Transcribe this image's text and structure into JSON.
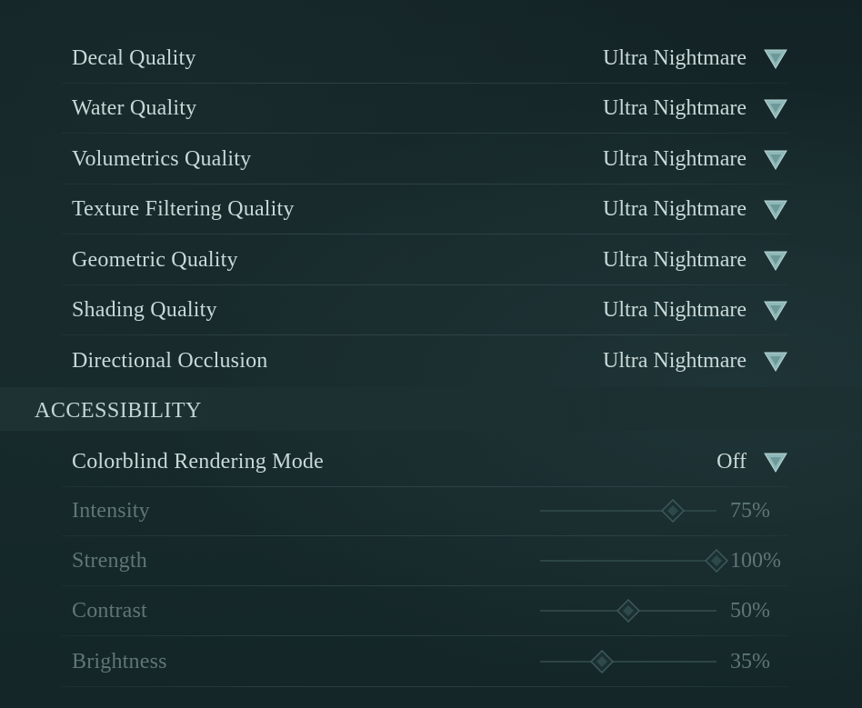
{
  "graphics_settings": [
    {
      "label": "Decal Quality",
      "value": "Ultra Nightmare"
    },
    {
      "label": "Water Quality",
      "value": "Ultra Nightmare"
    },
    {
      "label": "Volumetrics Quality",
      "value": "Ultra Nightmare"
    },
    {
      "label": "Texture Filtering Quality",
      "value": "Ultra Nightmare"
    },
    {
      "label": "Geometric Quality",
      "value": "Ultra Nightmare"
    },
    {
      "label": "Shading Quality",
      "value": "Ultra Nightmare"
    },
    {
      "label": "Directional Occlusion",
      "value": "Ultra Nightmare"
    }
  ],
  "accessibility": {
    "title": "ACCESSIBILITY",
    "colorblind": {
      "label": "Colorblind Rendering Mode",
      "value": "Off"
    },
    "sliders": [
      {
        "label": "Intensity",
        "value_text": "75%",
        "value": 75
      },
      {
        "label": "Strength",
        "value_text": "100%",
        "value": 100
      },
      {
        "label": "Contrast",
        "value_text": "50%",
        "value": 50
      },
      {
        "label": "Brightness",
        "value_text": "35%",
        "value": 35
      }
    ]
  },
  "colors": {
    "text": "#c9d9d8",
    "dim_text": "#5e7676",
    "accent": "#8fb8b8"
  },
  "icons": {
    "dropdown": "chevron-down-icon",
    "slider_handle": "diamond-handle-icon"
  }
}
